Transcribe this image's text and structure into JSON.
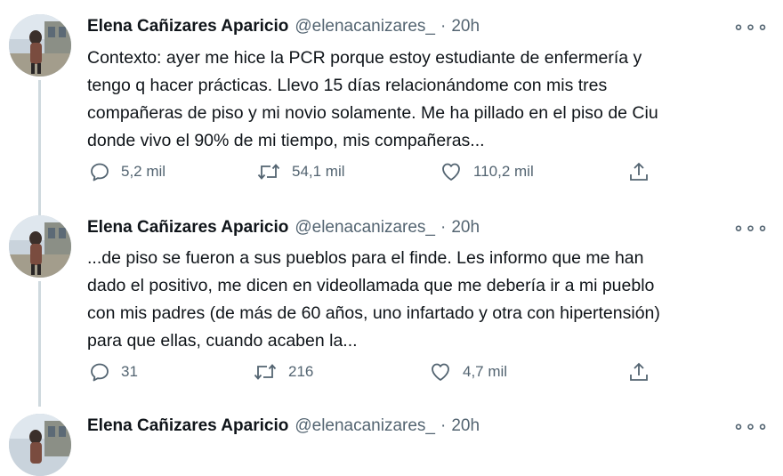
{
  "tweets": [
    {
      "author_name": "Elena Cañizares Aparicio",
      "handle": "@elenacanizares_",
      "separator": "·",
      "time": "20h",
      "more_label": "∘∘∘",
      "text_lines": [
        "Contexto: ayer me hice la PCR porque estoy estudiante de enfermería y",
        "tengo q hacer prácticas. Llevo 15 días relacionándome con mis tres",
        "compañeras de piso y mi novio solamente. Me ha pillado en el piso de Ciu",
        "donde vivo el 90% de mi tiempo, mis compañeras..."
      ],
      "replies": "5,2 mil",
      "retweets": "54,1 mil",
      "likes": "110,2 mil"
    },
    {
      "author_name": "Elena Cañizares Aparicio",
      "handle": "@elenacanizares_",
      "separator": "·",
      "time": "20h",
      "more_label": "∘∘∘",
      "text_lines": [
        "...de piso se fueron a sus pueblos para el finde. Les informo que me han",
        "dado el positivo, me dicen en videollamada que me debería ir a mi pueblo",
        "con mis padres (de más de 60 años, uno infartado y otra con hipertensión)",
        "para que ellas, cuando acaben la..."
      ],
      "replies": "31",
      "retweets": "216",
      "likes": "4,7 mil"
    },
    {
      "author_name": "Elena Cañizares Aparicio",
      "handle": "@elenacanizares_",
      "separator": "·",
      "time": "20h",
      "more_label": "∘∘∘"
    }
  ],
  "icons": {
    "avatar": "profile-photo",
    "reply": "reply-icon",
    "retweet": "retweet-icon",
    "like": "heart-icon",
    "share": "share-icon",
    "more": "more-options-icon"
  },
  "colors": {
    "text": "#0f1419",
    "secondary": "#536471",
    "thread_line": "#cfd9de"
  }
}
